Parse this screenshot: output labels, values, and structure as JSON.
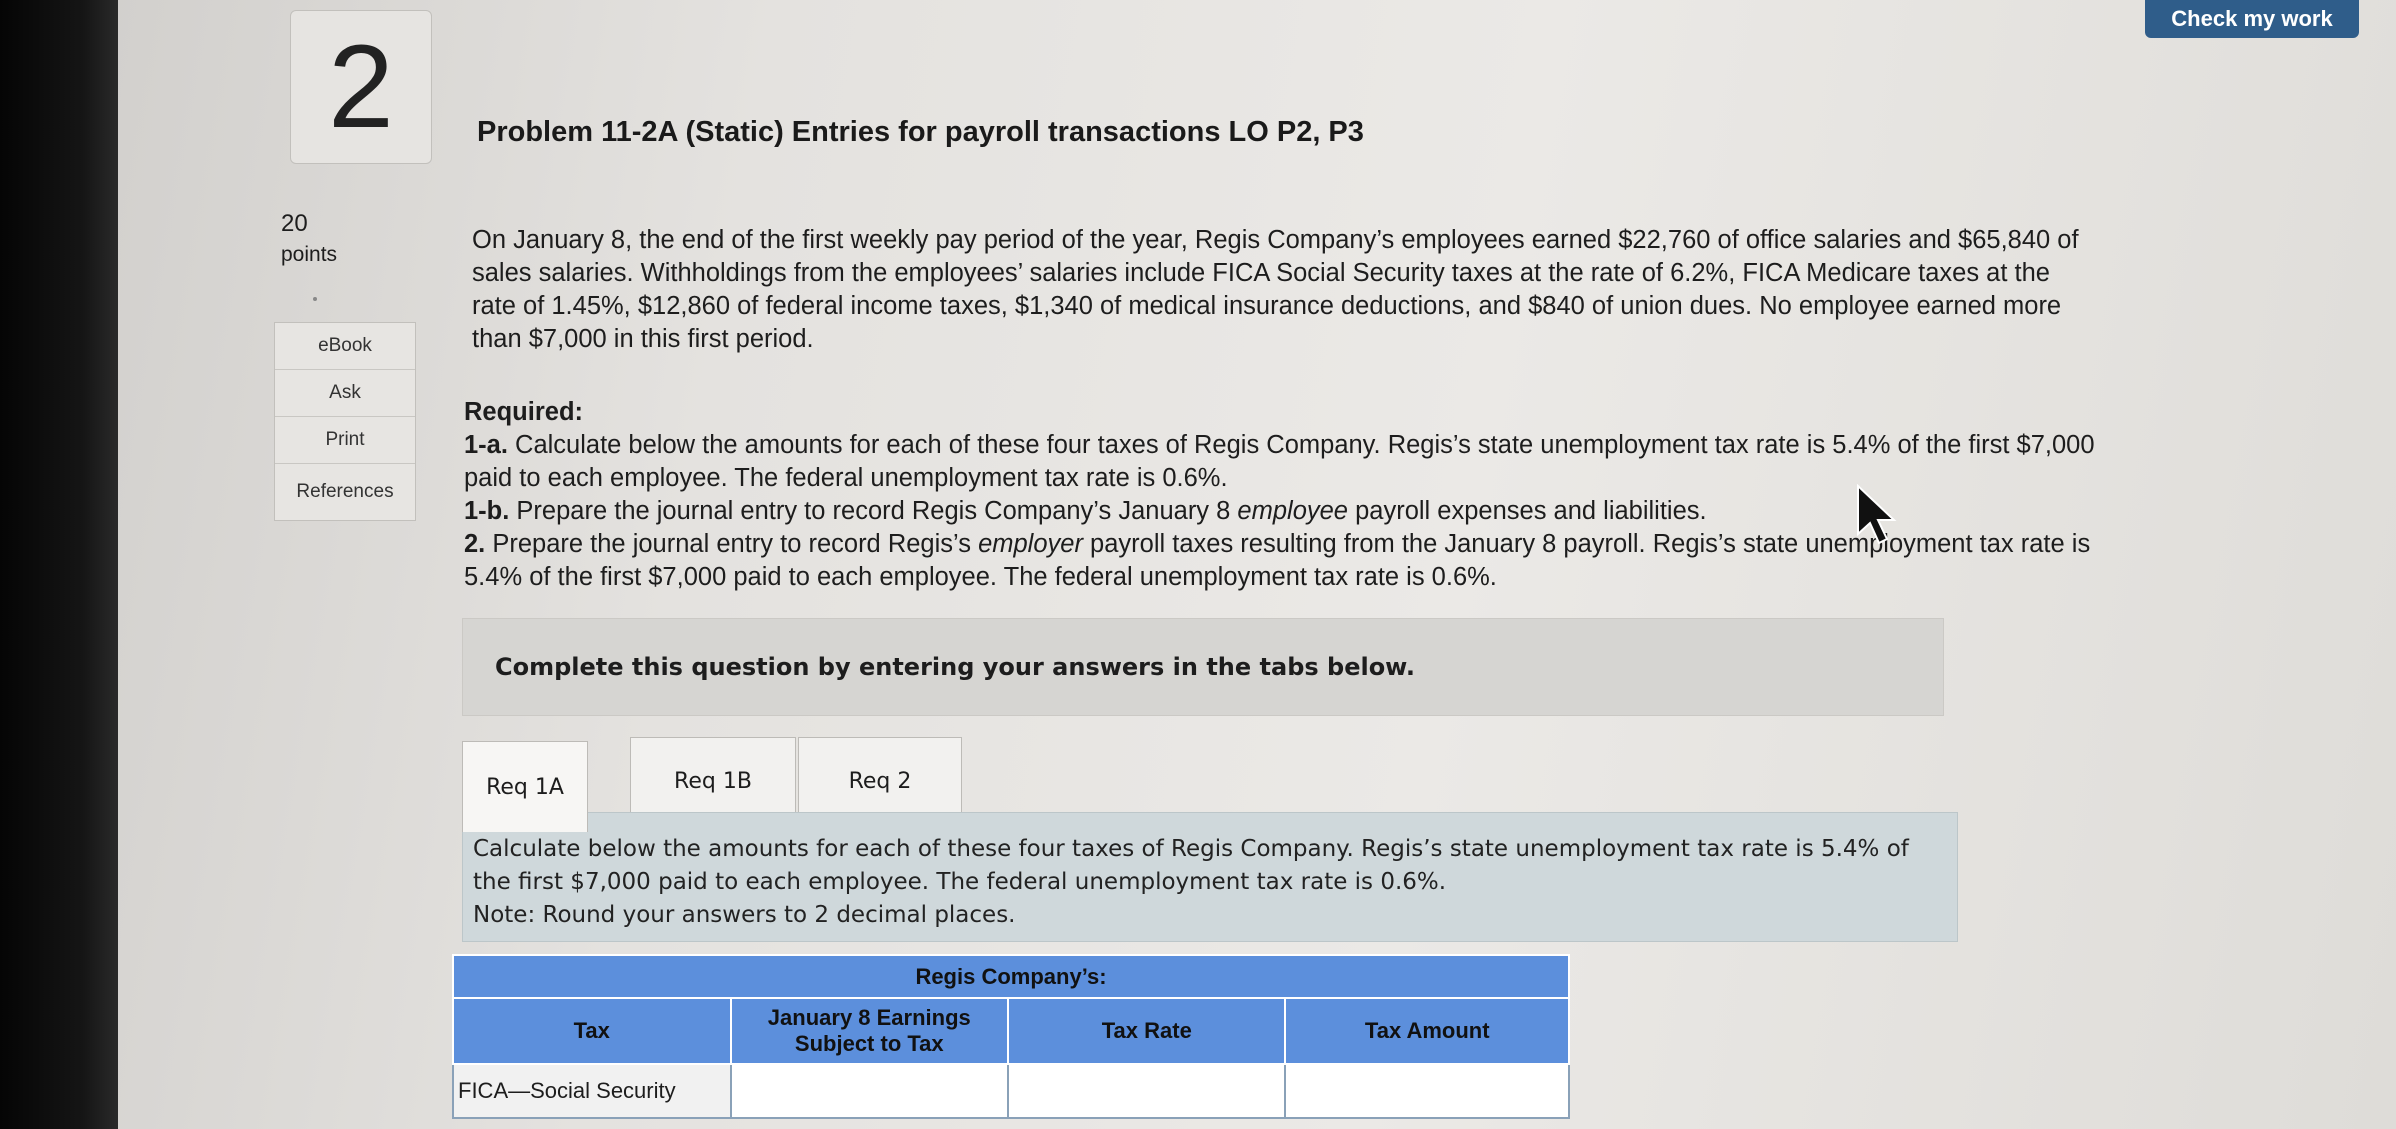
{
  "check_button": "Check my work",
  "question": {
    "number": "2",
    "points_value": "20",
    "points_label": "points"
  },
  "side_menu": [
    "eBook",
    "Ask",
    "Print",
    "References"
  ],
  "title": "Problem 11-2A (Static) Entries for payroll transactions LO P2, P3",
  "paragraph": "On January 8, the end of the first weekly pay period of the year, Regis Company’s employees earned $22,760 of office salaries and $65,840 of sales salaries. Withholdings from the employees’ salaries include FICA Social Security taxes at the rate of 6.2%, FICA Medicare taxes at the rate of 1.45%, $12,860 of federal income taxes, $1,340 of medical insurance deductions, and $840 of union dues. No employee earned more than $7,000 in this first period.",
  "required": {
    "heading": "Required:",
    "r1a_label": "1-a.",
    "r1a_text": " Calculate below the amounts for each of these four taxes of Regis Company. Regis’s state unemployment tax rate is 5.4% of the first $7,000 paid to each employee. The federal unemployment tax rate is 0.6%.",
    "r1b_label": "1-b.",
    "r1b_pre": " Prepare the journal entry to record Regis Company’s January 8 ",
    "r1b_em": "employee",
    "r1b_post": " payroll expenses and liabilities.",
    "r2_label": "2.",
    "r2_pre": " Prepare the journal entry to record Regis’s ",
    "r2_em": "employer",
    "r2_post": " payroll taxes resulting from the January 8 payroll. Regis’s state unemployment tax rate is 5.4% of the first $7,000 paid to each employee. The federal unemployment tax rate is 0.6%."
  },
  "complete_prompt": "Complete this question by entering your answers in the tabs below.",
  "tabs": [
    "Req 1A",
    "Req 1B",
    "Req 2"
  ],
  "active_tab": "Req 1A",
  "instructions": {
    "text": "Calculate below the amounts for each of these four taxes of Regis Company. Regis’s state unemployment tax rate is 5.4% of the first $7,000 paid to each employee. The federal unemployment tax rate is 0.6%.",
    "note": "Note: Round your answers to 2 decimal places."
  },
  "table": {
    "caption": "Regis Company’s:",
    "headers": [
      "Tax",
      "January 8 Earnings Subject to Tax",
      "Tax Rate",
      "Tax Amount"
    ],
    "rows": [
      {
        "tax": "FICA—Social Security",
        "earnings": "",
        "rate": "",
        "amount": ""
      }
    ]
  },
  "colors": {
    "header_blue": "#5c8fdc",
    "check_button": "#2f5d8a",
    "instruction_bg": "#cfd8db"
  },
  "icons": [
    "mouse-pointer-icon"
  ]
}
